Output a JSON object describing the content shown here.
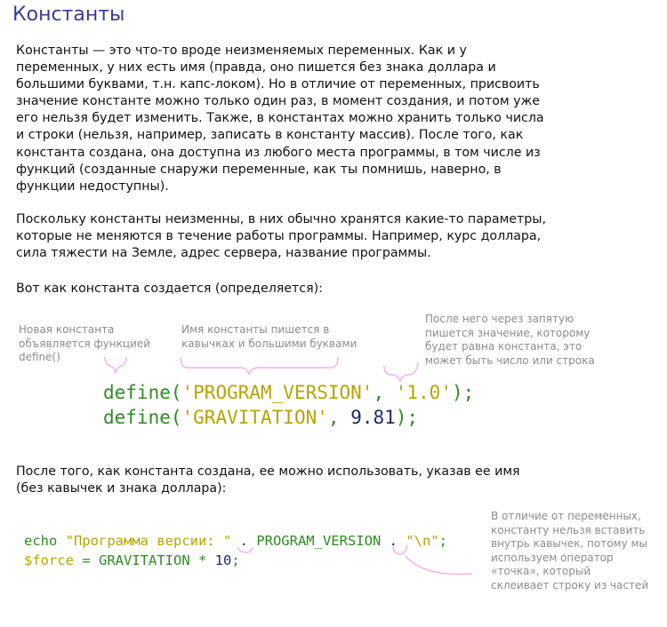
{
  "title": "Константы",
  "paragraphs": {
    "p1": "Константы — это что-то вроде неизменяемых переменных. Как и у переменных, у них есть имя (правда, оно пишется без знака доллара и большими буквами, т.н. капс-локом). Но в отличие от переменных, присвоить значение константе можно только один раз, в момент создания, и потом уже его нельзя будет изменить. Также, в константах можно хранить только числа и строки (нельзя, например, записать в константу массив). После того, как константа создана, она доступна из любого места программы, в том числе из функций (созданные снаружи переменные, как ты помнишь, наверно, в функции недоступны).",
    "p2": "Поскольку константы неизменны, в них обычно хранятся какие-то параметры, которые не меняются в течение работы программы. Например, курс доллара, сила тяжести на Земле, адрес сервера, название программы.",
    "p3": "Вот как константа создается (определяется):",
    "p4": "После того, как константа создана, ее можно использовать, указав ее имя (без кавычек и знака доллара):"
  },
  "notes": {
    "n1": "Новая константа объявляется функцией define()",
    "n2": "Имя константы пишется в кавычках и большими буквами",
    "n3": "После него через запятую пишется значение, которому будет равна константа, это может быть число или строка",
    "n4": "В отличие от переменных, константу нельзя вставить внутрь кавычек, потому мы используем оператор «точка», который склеивает строку из частей"
  },
  "code_define": {
    "l1_fn": "define(",
    "l1_name": "'PROGRAM_VERSION'",
    "l1_sep": ", ",
    "l1_val": "'1.0'",
    "l1_end": ");",
    "l2_fn": "define(",
    "l2_name": "'GRAVITATION'",
    "l2_sep": ", ",
    "l2_val": "9.81",
    "l2_end": ");"
  },
  "code_use": {
    "l1_echo": "echo ",
    "l1_str": "\"Программа версии: \"",
    "l1_dot1": " . ",
    "l1_const": "PROGRAM_VERSION",
    "l1_dot2": " . ",
    "l1_nl": "\"\\n\"",
    "l1_end": ";",
    "l2_var": "$force",
    "l2_eq": " = ",
    "l2_const": "GRAVITATION",
    "l2_mul": " * ",
    "l2_num": "10",
    "l2_end": ";"
  },
  "colors": {
    "title": "#3a3a9a",
    "keyword": "#2e8b22",
    "string": "#b5a400",
    "number": "#1e2a6a",
    "note": "#8c8c8c",
    "brace": "#f0b8e0"
  }
}
